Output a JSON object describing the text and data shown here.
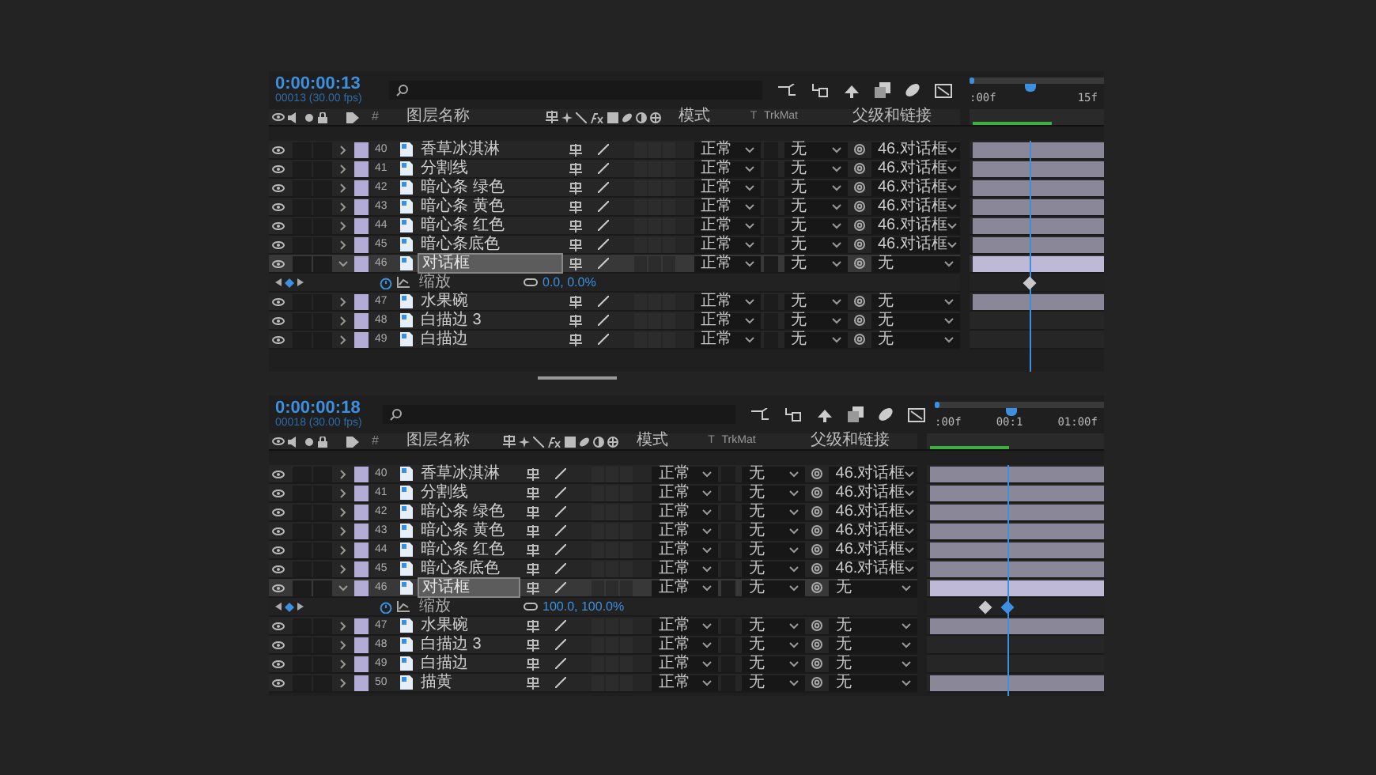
{
  "panels": [
    {
      "time": "0:00:00:13",
      "frames": "00013 (30.00 fps)",
      "columns": {
        "number": "#",
        "name": "图层名称",
        "mode": "模式",
        "t": "T",
        "trkmat": "TrkMat",
        "parent": "父级和链接"
      },
      "ruler": [
        ":00f",
        "15f"
      ],
      "playhead": {
        "level": 0.45
      },
      "layers": [
        {
          "number": "40",
          "name": "香草冰淇淋",
          "mode": "正常",
          "trkmat": "无",
          "parent": "46.对话框",
          "selected": false,
          "expanded": false,
          "bar": true
        },
        {
          "number": "41",
          "name": "分割线",
          "mode": "正常",
          "trkmat": "无",
          "parent": "46.对话框",
          "selected": false,
          "expanded": false,
          "bar": true
        },
        {
          "number": "42",
          "name": "暗心条 绿色",
          "mode": "正常",
          "trkmat": "无",
          "parent": "46.对话框",
          "selected": false,
          "expanded": false,
          "bar": true
        },
        {
          "number": "43",
          "name": "暗心条 黄色",
          "mode": "正常",
          "trkmat": "无",
          "parent": "46.对话框",
          "selected": false,
          "expanded": false,
          "bar": true
        },
        {
          "number": "44",
          "name": "暗心条 红色",
          "mode": "正常",
          "trkmat": "无",
          "parent": "46.对话框",
          "selected": false,
          "expanded": false,
          "bar": true
        },
        {
          "number": "45",
          "name": "暗心条底色",
          "mode": "正常",
          "trkmat": "无",
          "parent": "46.对话框",
          "selected": false,
          "expanded": false,
          "bar": true
        },
        {
          "number": "46",
          "name": "对话框",
          "mode": "正常",
          "trkmat": "无",
          "parent": "无",
          "selected": true,
          "expanded": true,
          "bar": true,
          "property": {
            "name": "缩放",
            "value": "0.0, 0.0%",
            "keyframes": [
              {
                "level": 0.45,
                "selected": false
              }
            ]
          }
        },
        {
          "number": "47",
          "name": "水果碗",
          "mode": "正常",
          "trkmat": "无",
          "parent": "无",
          "selected": false,
          "expanded": false,
          "bar": true
        },
        {
          "number": "48",
          "name": "白描边 3",
          "mode": "正常",
          "trkmat": "无",
          "parent": "无",
          "selected": false,
          "expanded": false,
          "bar": false
        },
        {
          "number": "49",
          "name": "白描边",
          "mode": "正常",
          "trkmat": "无",
          "parent": "无",
          "selected": false,
          "expanded": false,
          "bar": false
        }
      ]
    },
    {
      "time": "0:00:00:18",
      "frames": "00018 (30.00 fps)",
      "columns": {
        "number": "#",
        "name": "图层名称",
        "mode": "模式",
        "t": "T",
        "trkmat": "TrkMat",
        "parent": "父级和链接"
      },
      "ruler": [
        ":00f",
        "00:1",
        "01:00f"
      ],
      "playhead": {
        "level": 0.45
      },
      "layers": [
        {
          "number": "40",
          "name": "香草冰淇淋",
          "mode": "正常",
          "trkmat": "无",
          "parent": "46.对话框",
          "selected": false,
          "expanded": false,
          "bar": true
        },
        {
          "number": "41",
          "name": "分割线",
          "mode": "正常",
          "trkmat": "无",
          "parent": "46.对话框",
          "selected": false,
          "expanded": false,
          "bar": true
        },
        {
          "number": "42",
          "name": "暗心条 绿色",
          "mode": "正常",
          "trkmat": "无",
          "parent": "46.对话框",
          "selected": false,
          "expanded": false,
          "bar": true
        },
        {
          "number": "43",
          "name": "暗心条 黄色",
          "mode": "正常",
          "trkmat": "无",
          "parent": "46.对话框",
          "selected": false,
          "expanded": false,
          "bar": true
        },
        {
          "number": "44",
          "name": "暗心条 红色",
          "mode": "正常",
          "trkmat": "无",
          "parent": "46.对话框",
          "selected": false,
          "expanded": false,
          "bar": true
        },
        {
          "number": "45",
          "name": "暗心条底色",
          "mode": "正常",
          "trkmat": "无",
          "parent": "46.对话框",
          "selected": false,
          "expanded": false,
          "bar": true
        },
        {
          "number": "46",
          "name": "对话框",
          "mode": "正常",
          "trkmat": "无",
          "parent": "无",
          "selected": true,
          "expanded": true,
          "bar": true,
          "property": {
            "name": "缩放",
            "value": "100.0, 100.0%",
            "keyframes": [
              {
                "level": 0.33,
                "selected": false
              },
              {
                "level": 0.45,
                "selected": true
              }
            ]
          }
        },
        {
          "number": "47",
          "name": "水果碗",
          "mode": "正常",
          "trkmat": "无",
          "parent": "无",
          "selected": false,
          "expanded": false,
          "bar": true
        },
        {
          "number": "48",
          "name": "白描边 3",
          "mode": "正常",
          "trkmat": "无",
          "parent": "无",
          "selected": false,
          "expanded": false,
          "bar": false
        },
        {
          "number": "49",
          "name": "白描边",
          "mode": "正常",
          "trkmat": "无",
          "parent": "无",
          "selected": false,
          "expanded": false,
          "bar": false
        },
        {
          "number": "50",
          "name": "描黄",
          "mode": "正常",
          "trkmat": "无",
          "parent": "无",
          "selected": false,
          "expanded": false,
          "bar": true
        }
      ]
    }
  ]
}
